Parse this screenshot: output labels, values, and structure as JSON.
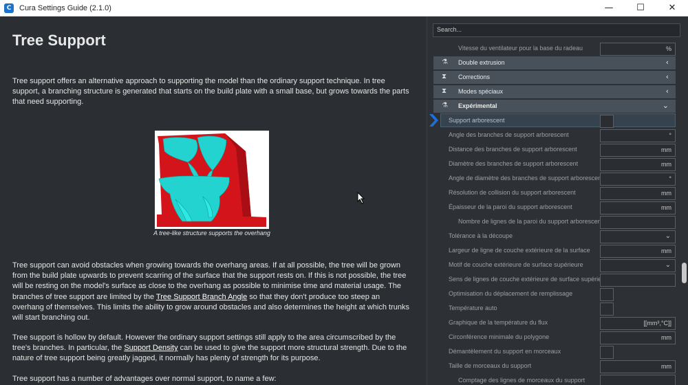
{
  "window": {
    "title": "Cura Settings Guide (2.1.0)",
    "minimize": "—",
    "maximize": "☐",
    "close": "✕"
  },
  "article": {
    "heading": "Tree Support",
    "intro": "Tree support offers an alternative approach to supporting the model than the ordinary support technique. In tree support, a branching structure is generated that starts on the build plate with a small base, but grows towards the parts that need supporting.",
    "caption": "A tree-like structure supports the overhang",
    "p2_a": "Tree support can avoid obstacles when growing towards the overhang areas. If at all possible, the tree will be grown from the build plate upwards to prevent scarring of the surface that the support rests on. If this is not possible, the tree will be resting on the model's surface as close to the overhang as possible to minimise time and material usage. The branches of tree support are limited by the ",
    "p2_link": "Tree Support Branch Angle",
    "p2_b": " so that they don't produce too steep an overhang of themselves. This limits the ability to grow around obstacles and also determines the height at which trunks will start branching out.",
    "p3_a": "Tree support is hollow by default. However the ordinary support settings still apply to the area circumscribed by the tree's branches. In particular, the ",
    "p3_link": "Support Density",
    "p3_b": " can be used to give the support more structural strength. Due to the nature of tree support being greatly jagged, it normally has plenty of strength for its purpose.",
    "p4": "Tree support has a number of advantages over normal support, to name a few:"
  },
  "panel": {
    "search_placeholder": "Search...",
    "top_row": {
      "label": "Vitesse du ventilateur pour la base du radeau",
      "unit": "%"
    },
    "categories": [
      {
        "label": "Double extrusion",
        "arrow": "‹"
      },
      {
        "label": "Corrections",
        "arrow": "‹"
      },
      {
        "label": "Modes spéciaux",
        "arrow": "‹"
      },
      {
        "label": "Expérimental",
        "arrow": "⌄"
      }
    ],
    "settings": [
      {
        "label": "Support arborescent",
        "kind": "check",
        "unit": ""
      },
      {
        "label": "Angle des branches de support arborescent",
        "kind": "field",
        "unit": "°"
      },
      {
        "label": "Distance des branches de support arborescent",
        "kind": "field",
        "unit": "mm"
      },
      {
        "label": "Diamètre des branches de support arborescent",
        "kind": "field",
        "unit": "mm"
      },
      {
        "label": "Angle de diamètre des branches de support arborescent",
        "kind": "field",
        "unit": "°"
      },
      {
        "label": "Résolution de collision du support arborescent",
        "kind": "field",
        "unit": "mm"
      },
      {
        "label": "Épaisseur de la paroi du support arborescent",
        "kind": "field",
        "unit": "mm"
      },
      {
        "label": "Nombre de lignes de la paroi du support arborescent",
        "kind": "field",
        "unit": ""
      },
      {
        "label": "Tolérance à la découpe",
        "kind": "drop",
        "unit": ""
      },
      {
        "label": "Largeur de ligne de couche extérieure de la surface",
        "kind": "field",
        "unit": "mm"
      },
      {
        "label": "Motif de couche extérieure de surface supérieure",
        "kind": "drop",
        "unit": ""
      },
      {
        "label": "Sens de lignes de couche extérieure de surface supérieure",
        "kind": "field",
        "unit": ""
      },
      {
        "label": "Optimisation du déplacement de remplissage",
        "kind": "check",
        "unit": ""
      },
      {
        "label": "Température auto",
        "kind": "check",
        "unit": ""
      },
      {
        "label": "Graphique de la température du flux",
        "kind": "field",
        "unit": "[[mm³,°C]]"
      },
      {
        "label": "Circonférence minimale du polygone",
        "kind": "field",
        "unit": "mm"
      },
      {
        "label": "Démantèlement du support en morceaux",
        "kind": "check",
        "unit": ""
      },
      {
        "label": "Taille de morceaux du support",
        "kind": "field",
        "unit": "mm"
      },
      {
        "label": "Comptage des lignes de morceaux du support",
        "kind": "field",
        "unit": ""
      }
    ]
  },
  "colors": {
    "background": "#2b2f33",
    "panel": "#2d3136",
    "category": "#48515a",
    "highlight": "#36434f",
    "pointer": "#1e6fd8",
    "support_cyan": "#22d3cf",
    "model_red": "#d4141b"
  }
}
